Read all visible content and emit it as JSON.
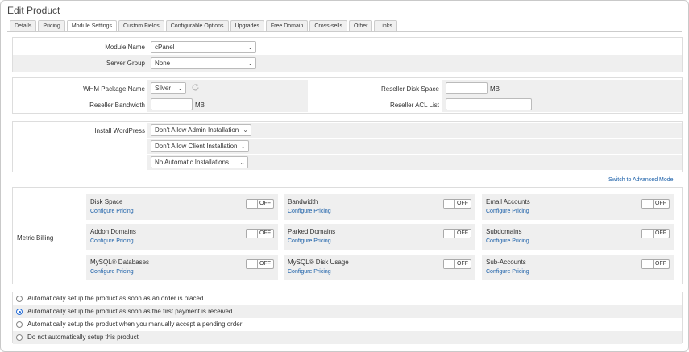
{
  "page_title": "Edit Product",
  "tabs": [
    "Details",
    "Pricing",
    "Module Settings",
    "Custom Fields",
    "Configurable Options",
    "Upgrades",
    "Free Domain",
    "Cross-sells",
    "Other",
    "Links"
  ],
  "module": {
    "module_name_label": "Module Name",
    "module_name_value": "cPanel",
    "server_group_label": "Server Group",
    "server_group_value": "None"
  },
  "package": {
    "whm_package_label": "WHM Package Name",
    "whm_package_value": "Silver",
    "reseller_bandwidth_label": "Reseller Bandwidth",
    "reseller_bandwidth_unit": "MB",
    "reseller_disk_label": "Reseller Disk Space",
    "reseller_disk_unit": "MB",
    "reseller_acl_label": "Reseller ACL List"
  },
  "wordpress": {
    "label": "Install WordPress",
    "admin_value": "Don't Allow Admin Installation",
    "client_value": "Don't Allow Client Installation",
    "auto_value": "No Automatic Installations"
  },
  "advanced_link": "Switch to Advanced Mode",
  "metric_billing": {
    "label": "Metric Billing",
    "configure_label": "Configure Pricing",
    "toggle_label": "OFF",
    "metrics": [
      "Disk Space",
      "Bandwidth",
      "Email Accounts",
      "Addon Domains",
      "Parked Domains",
      "Subdomains",
      "MySQL® Databases",
      "MySQL® Disk Usage",
      "Sub-Accounts"
    ]
  },
  "setup_options": {
    "selected_index": 1,
    "options": [
      "Automatically setup the product as soon as an order is placed",
      "Automatically setup the product as soon as the first payment is received",
      "Automatically setup the product when you manually accept a pending order",
      "Do not automatically setup this product"
    ]
  }
}
